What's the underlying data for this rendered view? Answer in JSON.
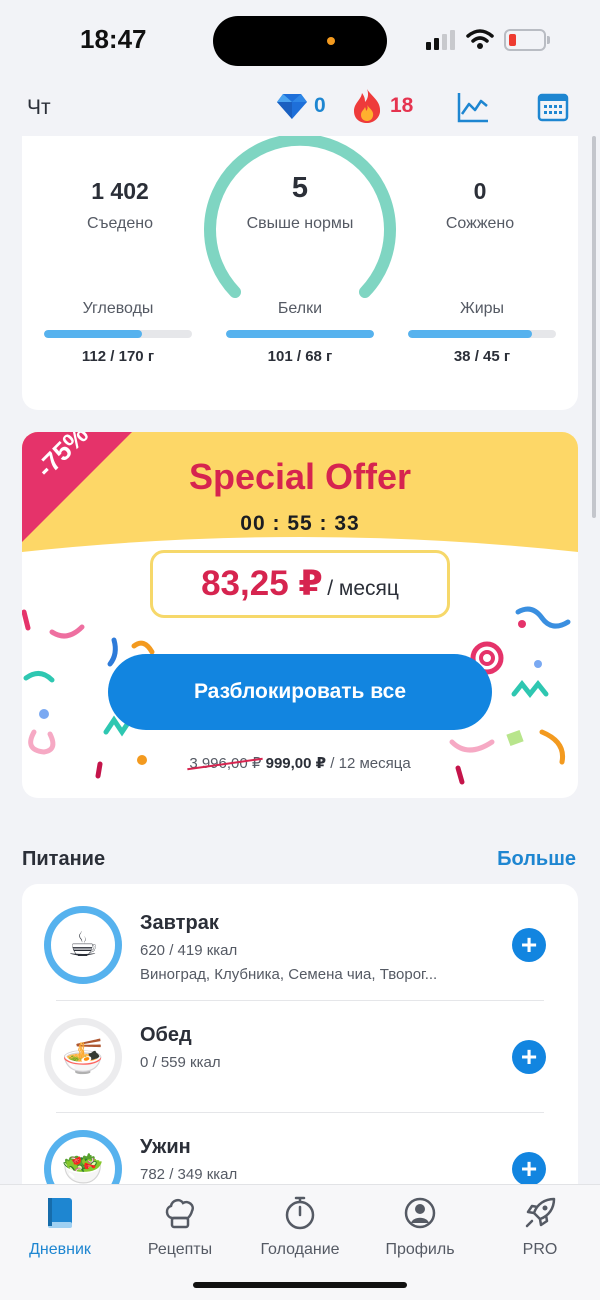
{
  "status_bar": {
    "time": "18:47"
  },
  "header": {
    "day": "Чт",
    "gems": "0",
    "streak": "18"
  },
  "summary": {
    "eaten_value": "1 402",
    "eaten_label": "Съедено",
    "center_value": "5",
    "center_label": "Свыше нормы",
    "burned_value": "0",
    "burned_label": "Сожжено",
    "macros": [
      {
        "label": "Углеводы",
        "value": "112 / 170 г",
        "progress": 0.66
      },
      {
        "label": "Белки",
        "value": "101 / 68 г",
        "progress": 1.0
      },
      {
        "label": "Жиры",
        "value": "38 / 45 г",
        "progress": 0.84
      }
    ]
  },
  "offer": {
    "discount": "-75%",
    "title": "Special Offer",
    "timer": "00 : 55 : 33",
    "price": "83,25 ₽",
    "per": "/ месяц",
    "button": "Разблокировать все",
    "old_price": "3 996,00 ₽",
    "new_price": "999,00 ₽",
    "period": "/ 12 месяца",
    "colors": {
      "banner": "#fdd767",
      "ribbon": "#e5336a",
      "accent": "#d6244f",
      "button": "#1285e0"
    }
  },
  "nutrition": {
    "title": "Питание",
    "more": "Больше",
    "meals": [
      {
        "name": "Завтрак",
        "kcal": "620 / 419 ккал",
        "items": "Виноград, Клубника, Семена чиа, Творог...",
        "icon": "coffee-cup-icon",
        "emoji": "☕"
      },
      {
        "name": "Обед",
        "kcal": "0 / 559 ккал",
        "items": "",
        "icon": "soup-bowl-icon",
        "emoji": "🍜"
      },
      {
        "name": "Ужин",
        "kcal": "782 / 349 ккал",
        "items": "",
        "icon": "salad-bowl-icon",
        "emoji": "🥗"
      }
    ]
  },
  "tabs": [
    {
      "label": "Дневник",
      "icon": "book-icon",
      "active": true
    },
    {
      "label": "Рецепты",
      "icon": "chef-hat-icon",
      "active": false
    },
    {
      "label": "Голодание",
      "icon": "stopwatch-icon",
      "active": false
    },
    {
      "label": "Профиль",
      "icon": "profile-icon",
      "active": false
    },
    {
      "label": "PRO",
      "icon": "rocket-icon",
      "active": false
    }
  ]
}
